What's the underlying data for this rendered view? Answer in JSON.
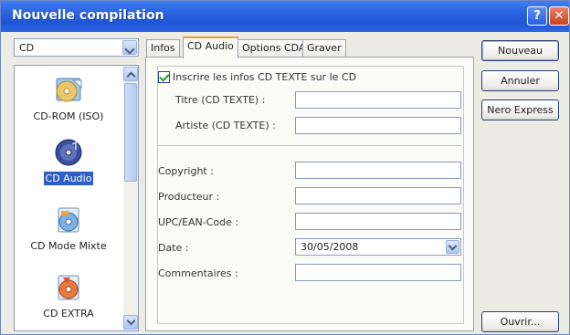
{
  "window": {
    "title": "Nouvelle compilation"
  },
  "left_pane": {
    "format_select": {
      "value": "CD"
    },
    "items": [
      {
        "label": "CD-ROM (ISO)",
        "icon": "cd-rom-disc-icon"
      },
      {
        "label": "CD Audio",
        "icon": "cd-audio-disc-icon",
        "selected": true
      },
      {
        "label": "CD Mode Mixte",
        "icon": "cd-mixed-mode-disc-icon"
      },
      {
        "label": "CD EXTRA",
        "icon": "cd-extra-disc-icon"
      }
    ]
  },
  "tabs": [
    {
      "label": "Infos",
      "active": false
    },
    {
      "label": "CD Audio",
      "active": true
    },
    {
      "label": "Options CDA",
      "active": false
    },
    {
      "label": "Graver",
      "active": false
    }
  ],
  "cd_audio_tab": {
    "cd_text_checkbox": {
      "label": "Inscrire les infos CD TEXTE sur le CD",
      "checked": true
    },
    "cd_text_title": {
      "label": "Titre (CD TEXTE) :",
      "value": ""
    },
    "cd_text_artist": {
      "label": "Artiste (CD TEXTE) :",
      "value": ""
    },
    "copyright": {
      "label": "Copyright :",
      "value": ""
    },
    "producer": {
      "label": "Producteur :",
      "value": ""
    },
    "upc_ean": {
      "label": "UPC/EAN-Code :",
      "value": ""
    },
    "date": {
      "label": "Date :",
      "value": "30/05/2008"
    },
    "comments": {
      "label": "Commentaires :",
      "value": ""
    }
  },
  "buttons": {
    "new": "Nouveau",
    "cancel": "Annuler",
    "nero_express": "Nero Express",
    "open": "Ouvrir..."
  },
  "colors": {
    "titlebar": "#2a62e0",
    "selection": "#2f5fc4",
    "active_tab_accent": "#e8a23a",
    "checkmark": "#1f9d22"
  }
}
